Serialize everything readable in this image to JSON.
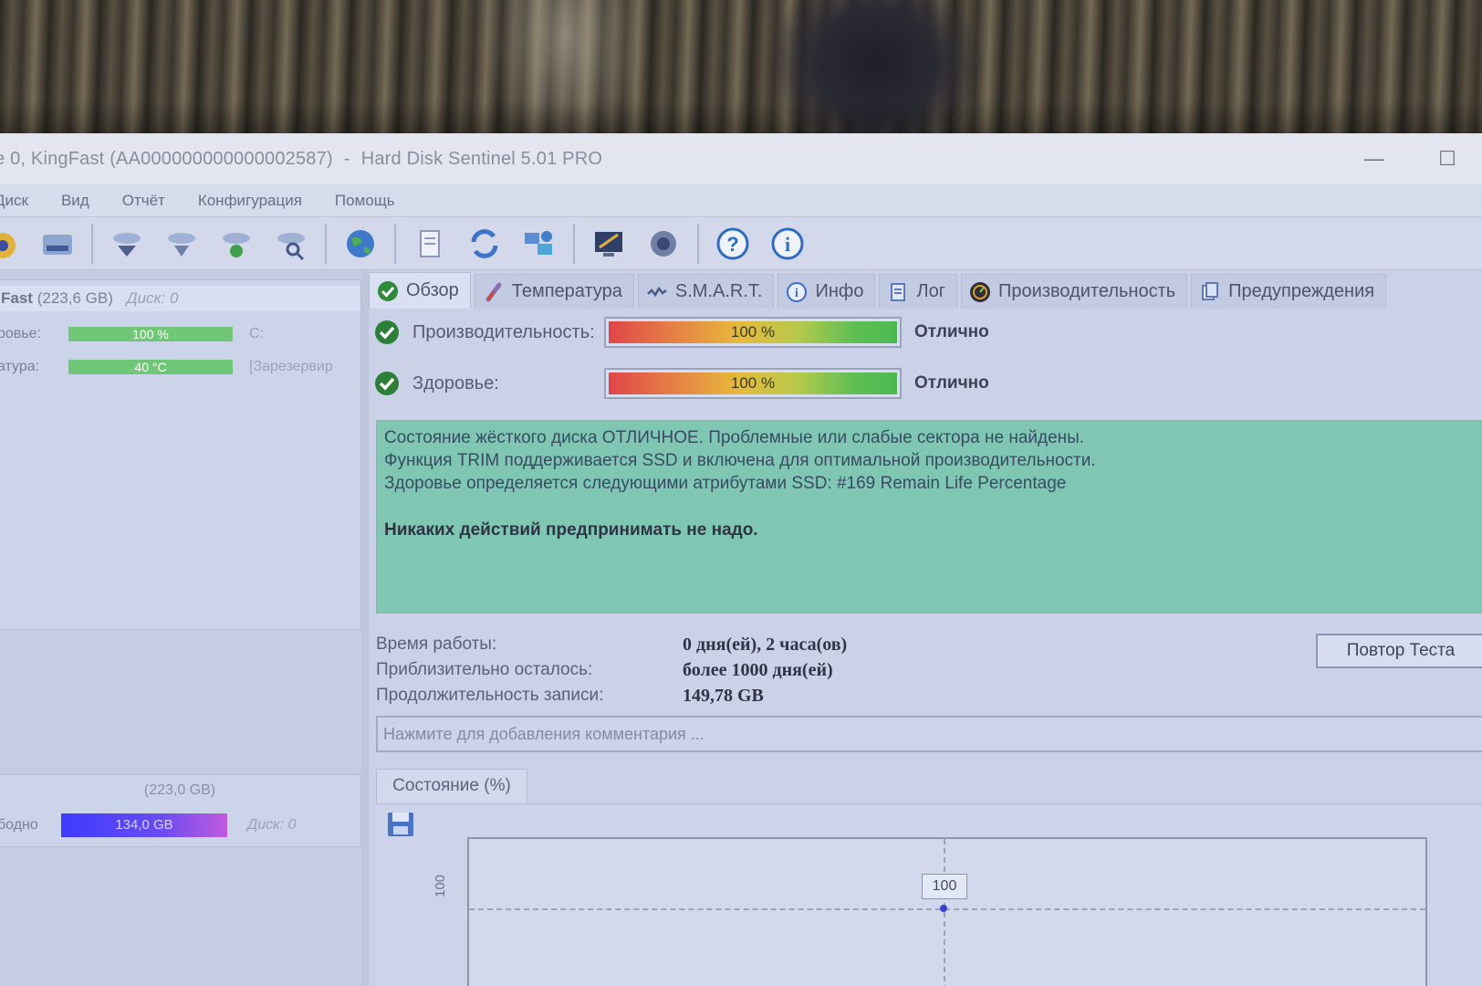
{
  "window": {
    "title_left": "е 0, KingFast (AA000000000000002587)",
    "title_sep": "-",
    "title_app": "Hard Disk Sentinel 5.01 PRO"
  },
  "menu": [
    "Диск",
    "Вид",
    "Отчёт",
    "Конфигурация",
    "Помощь"
  ],
  "toolbar_icons": [
    "disk-icon",
    "drive-icon",
    "refresh-disk-icon",
    "disk-scan-icon",
    "disk-check-icon",
    "disk-search-icon",
    "globe-icon",
    "document-icon",
    "sync-icon",
    "network-icon",
    "monitor-icon",
    "speaker-icon",
    "help-icon",
    "info-icon"
  ],
  "disk": {
    "name": "Fast",
    "size": "(223,6 GB)",
    "disk_no": "Диск: 0",
    "health_label": "ровье:",
    "health_value": "100 %",
    "health_extra": "C:",
    "temp_label": "атура:",
    "temp_value": "40 °C",
    "temp_extra": "[Зарезервир"
  },
  "partition": {
    "size": "(223,0 GB)",
    "free_label": "бодно",
    "free_value": "134,0 GB",
    "disk_no": "Диск: 0"
  },
  "tabs": [
    {
      "label": "Обзор",
      "icon": "check-icon"
    },
    {
      "label": "Температура",
      "icon": "thermometer-icon"
    },
    {
      "label": "S.M.A.R.T.",
      "icon": "smart-icon"
    },
    {
      "label": "Инфо",
      "icon": "info-icon"
    },
    {
      "label": "Лог",
      "icon": "log-icon"
    },
    {
      "label": "Производительность",
      "icon": "speedometer-icon"
    },
    {
      "label": "Предупреждения",
      "icon": "warnings-icon"
    }
  ],
  "performance": {
    "label": "Производительность:",
    "value": "100 %",
    "percent": 100,
    "verdict": "Отлично"
  },
  "health": {
    "label": "Здоровье:",
    "value": "100 %",
    "percent": 100,
    "verdict": "Отлично"
  },
  "status": {
    "line1": "Состояние жёсткого диска ОТЛИЧНОЕ. Проблемные или слабые сектора не найдены.",
    "line2": "Функция TRIM поддерживается SSD и включена для оптимальной производительности.",
    "line3": "Здоровье определяется следующими атрибутами SSD: #169 Remain Life Percentage",
    "action": "Никаких действий предпринимать не надо."
  },
  "info": {
    "uptime_label": "Время работы:",
    "uptime_value": "0 дня(ей), 2 часа(ов)",
    "remaining_label": "Приблизительно осталось:",
    "remaining_value": "более 1000 дня(ей)",
    "written_label": "Продолжительность записи:",
    "written_value": "149,78 GB"
  },
  "retest_button": "Повтор Теста",
  "comment_placeholder": "Нажмите для добавления комментария ...",
  "chart_tab": "Состояние (%)",
  "chart_data": {
    "type": "line",
    "title": "",
    "xlabel": "",
    "ylabel": "",
    "y_ticks": [
      "100"
    ],
    "series": [
      {
        "values": [
          100
        ]
      }
    ],
    "data_labels": [
      "100"
    ],
    "grid": true
  }
}
